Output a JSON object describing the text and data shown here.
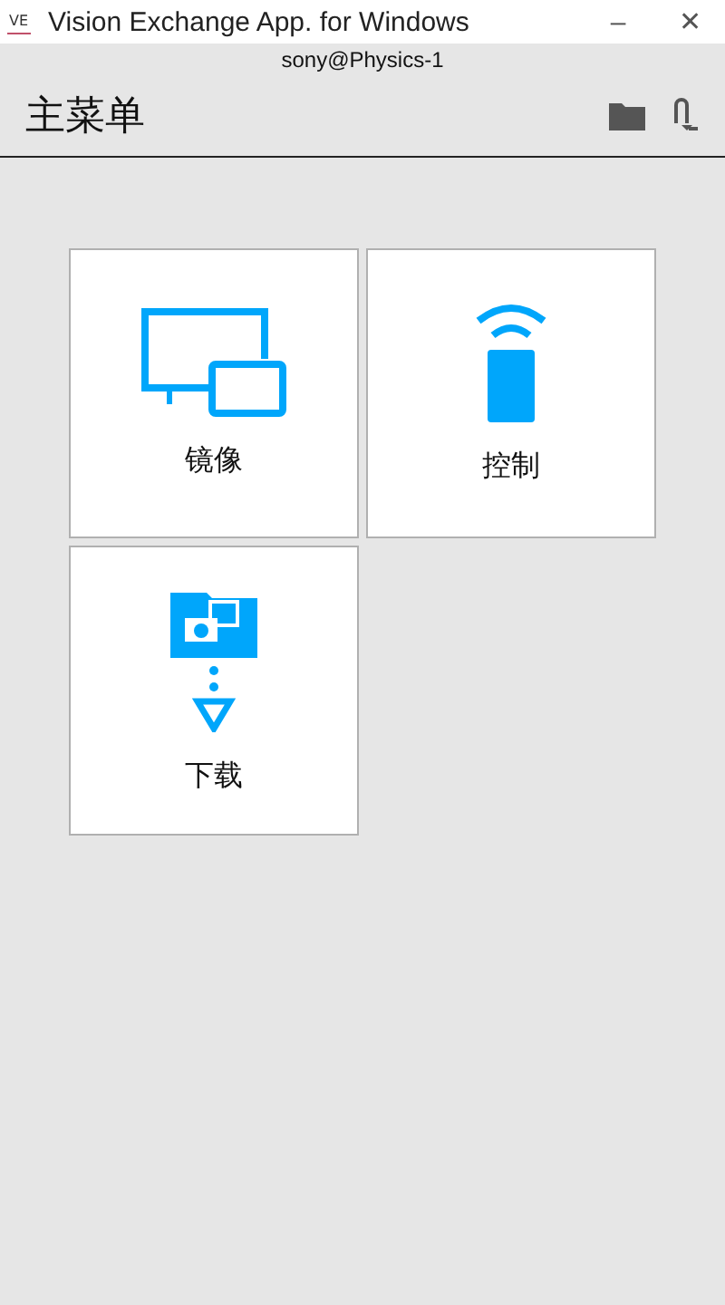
{
  "window": {
    "icon": "VE",
    "title": "Vision Exchange App. for Windows",
    "minimize": "‒",
    "close": "✕"
  },
  "account": "sony@Physics-1",
  "header": {
    "title": "主菜单"
  },
  "tiles": [
    {
      "kind": "mirror",
      "label": "镜像"
    },
    {
      "kind": "remote",
      "label": "控制"
    },
    {
      "kind": "download",
      "label": "下载"
    }
  ]
}
